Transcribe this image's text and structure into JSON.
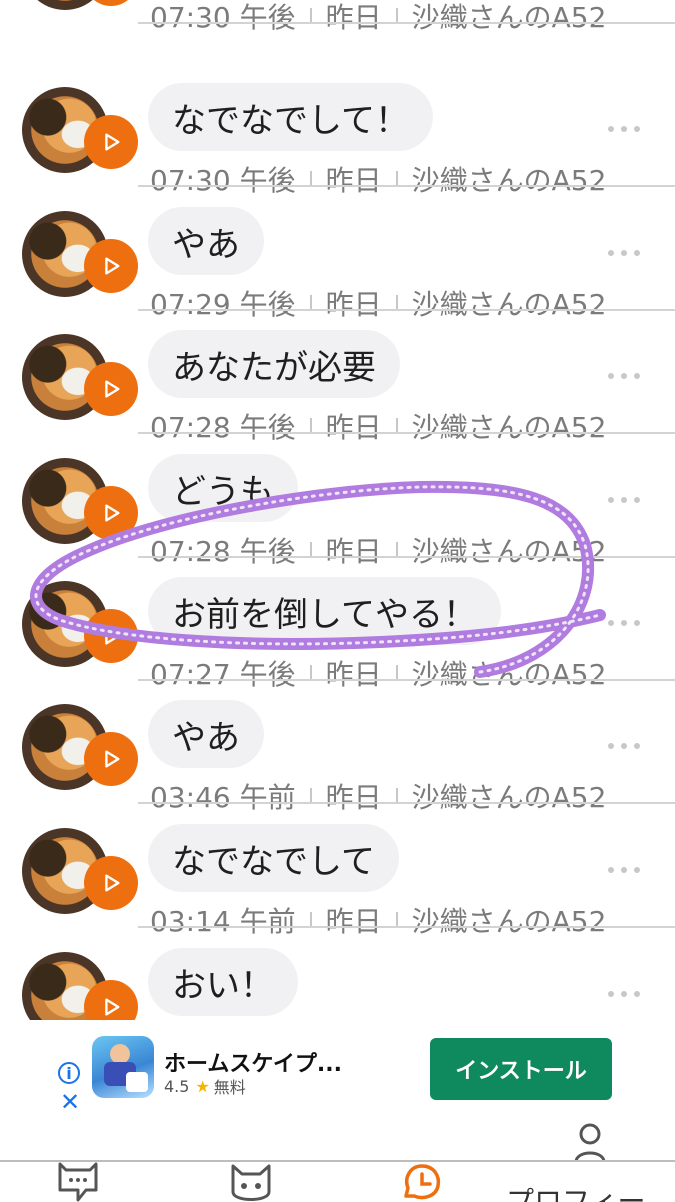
{
  "messages": [
    {
      "text": "",
      "time": "07:30 午後",
      "day": "昨日",
      "device": "沙織さんのA52"
    },
    {
      "text": "なでなでして！",
      "time": "07:30 午後",
      "day": "昨日",
      "device": "沙織さんのA52"
    },
    {
      "text": "やあ",
      "time": "07:29 午後",
      "day": "昨日",
      "device": "沙織さんのA52"
    },
    {
      "text": "あなたが必要",
      "time": "07:28 午後",
      "day": "昨日",
      "device": "沙織さんのA52"
    },
    {
      "text": "どうも",
      "time": "07:28 午後",
      "day": "昨日",
      "device": "沙織さんのA52"
    },
    {
      "text": "お前を倒してやる！",
      "time": "07:27 午後",
      "day": "昨日",
      "device": "沙織さんのA52"
    },
    {
      "text": "やあ",
      "time": "03:46 午前",
      "day": "昨日",
      "device": "沙織さんのA52"
    },
    {
      "text": "なでなでして",
      "time": "03:14 午前",
      "day": "昨日",
      "device": "沙織さんのA52"
    },
    {
      "text": "おい！",
      "time": "",
      "day": "",
      "device": ""
    }
  ],
  "ad": {
    "title": "ホームスケイプ...",
    "rating": "4.5",
    "price": "無料",
    "install_label": "インストール",
    "info_glyph": "i",
    "close_glyph": "✕",
    "star_glyph": "★"
  },
  "nav": {
    "profile_label": "プロフィー"
  },
  "colors": {
    "play_button": "#ee6f0f",
    "bubble_bg": "#f1f1f3",
    "install_button": "#0f8a5f",
    "highlight_stroke": "#b07ce0"
  },
  "icons": {
    "play": "play-icon",
    "more": "more-dots-icon",
    "chat_nav": "cat-chat-icon",
    "cat_nav": "cat-face-icon",
    "history_nav": "clock-icon",
    "profile_nav": "person-icon"
  }
}
